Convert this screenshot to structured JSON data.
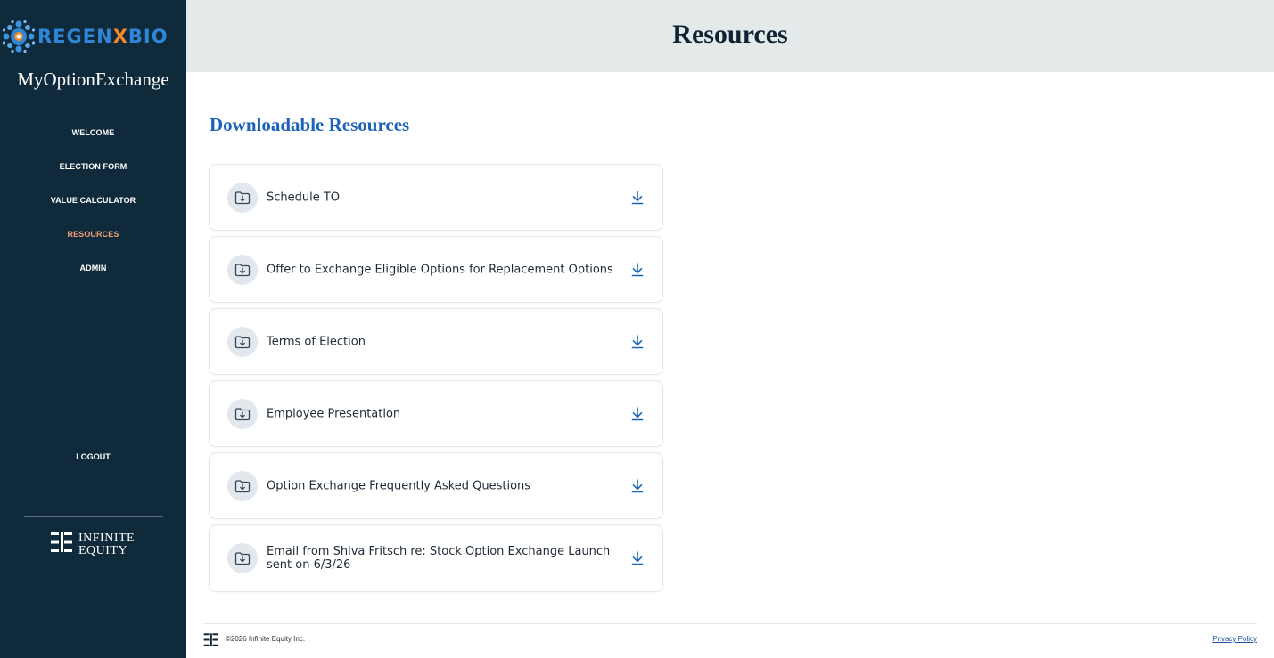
{
  "brand": {
    "name_prefix": "REGEN",
    "name_x": "X",
    "name_suffix": "BIO"
  },
  "app": {
    "title": "MyOptionExchange"
  },
  "sidebar": {
    "items": [
      {
        "label": "WELCOME"
      },
      {
        "label": "ELECTION FORM"
      },
      {
        "label": "VALUE CALCULATOR"
      },
      {
        "label": "RESOURCES",
        "active": true
      },
      {
        "label": "ADMIN"
      }
    ],
    "logout_label": "LOGOUT",
    "partner_logo": {
      "line1": "INFINITE",
      "line2": "EQUITY"
    }
  },
  "header": {
    "title": "Resources"
  },
  "main": {
    "section_title": "Downloadable Resources",
    "resources": [
      {
        "label": "Schedule TO"
      },
      {
        "label": "Offer to Exchange Eligible Options for Replacement Options"
      },
      {
        "label": "Terms of Election"
      },
      {
        "label": "Employee Presentation"
      },
      {
        "label": "Option Exchange Frequently Asked Questions"
      },
      {
        "label": "Email from Shiva Fritsch re: Stock Option Exchange Launch sent on 6/3/26"
      }
    ]
  },
  "footer": {
    "copyright": "©2026 Infinite Equity Inc.",
    "privacy_label": "Privacy Policy"
  },
  "colors": {
    "sidebar_bg": "#0f2a3a",
    "header_bg": "#e4e9ea",
    "accent_blue": "#1d63b8",
    "active_nav": "#f0a07a",
    "brand_blue": "#2f86d6",
    "brand_orange": "#f08a2a"
  },
  "icons": [
    "folder-download-icon",
    "download-arrow-icon",
    "infinite-equity-logo-icon"
  ]
}
